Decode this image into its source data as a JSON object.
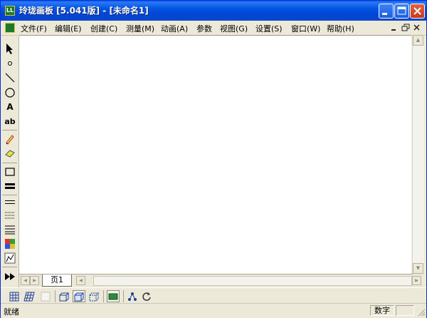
{
  "window": {
    "title": "玲珑画板 [5.041版] - [未命名1]",
    "app_icon_text": "LL"
  },
  "menu": {
    "items": [
      "文件(F)",
      "编辑(E)",
      "创建(C)",
      "测量(M)",
      "动画(A)",
      "参数",
      "视图(G)",
      "设置(S)",
      "窗口(W)",
      "帮助(H)"
    ]
  },
  "tools": [
    {
      "name": "select-arrow-icon"
    },
    {
      "name": "point-icon"
    },
    {
      "name": "line-icon"
    },
    {
      "name": "circle-icon"
    },
    {
      "name": "text-tool-icon",
      "label": "A"
    },
    {
      "name": "label-tool-icon",
      "label": "ab"
    },
    {
      "name": "pencil-icon"
    },
    {
      "name": "eraser-icon"
    },
    {
      "name": "rectangle-icon"
    },
    {
      "name": "thick-line-icon"
    },
    {
      "name": "thin-line-icon"
    },
    {
      "name": "dotted-line-icon"
    },
    {
      "name": "multi-line-icon"
    },
    {
      "name": "color-palette-icon"
    },
    {
      "name": "graph-icon"
    },
    {
      "name": "animation-play-icon"
    }
  ],
  "tabs": {
    "page_label": "页1"
  },
  "status": {
    "left": "就绪",
    "numlock": "数字"
  },
  "colors": {
    "titlebar": "#0054e3",
    "window_face": "#ece9d8",
    "canvas": "#ffffff"
  }
}
